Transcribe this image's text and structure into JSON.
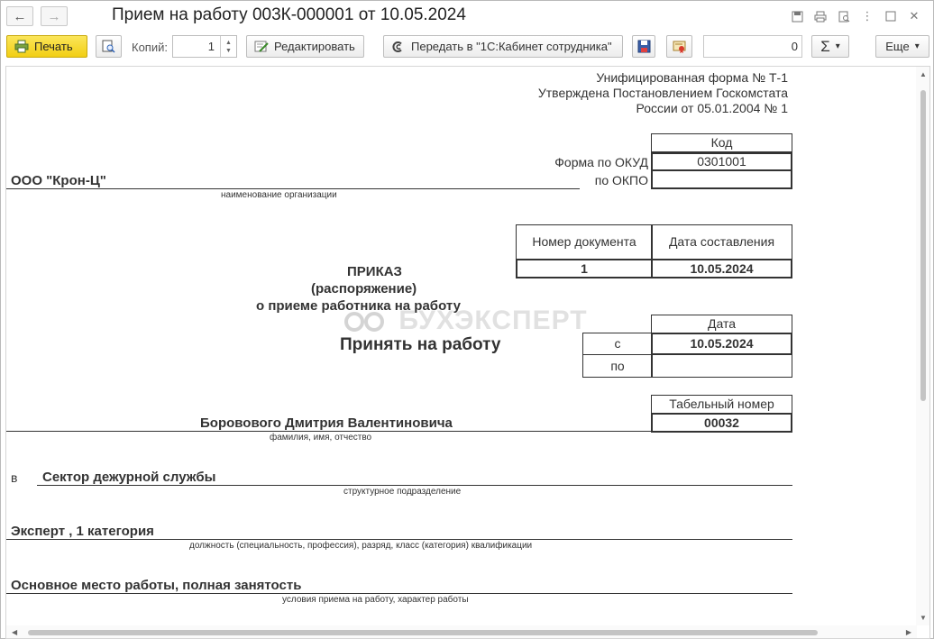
{
  "window": {
    "title": "Прием на работу 003К-000001 от 10.05.2024",
    "back_icon": "arrow-left-icon",
    "forward_icon": "arrow-right-icon"
  },
  "toolbar": {
    "print_label": "Печать",
    "copies_label": "Копий:",
    "copies_value": "1",
    "edit_label": "Редактировать",
    "send_label": "Передать в \"1С:Кабинет сотрудника\"",
    "counter_value": "0",
    "sum_label": "Σ",
    "more_label": "Еще",
    "dropdown_glyph": "▾"
  },
  "form": {
    "header_line1": "Унифицированная форма № Т-1",
    "header_line2": "Утверждена Постановлением Госкомстата",
    "header_line3": "России от 05.01.2004 № 1",
    "code_header": "Код",
    "okud_label": "Форма по ОКУД",
    "okud_value": "0301001",
    "okpo_label": "по ОКПО",
    "okpo_value": "",
    "organization": "ООО \"Крон-Ц\"",
    "organization_caption": "наименование организации",
    "doc_number_header": "Номер документа",
    "doc_date_header": "Дата составления",
    "doc_number": "1",
    "doc_date": "10.05.2024",
    "title_line1": "ПРИКАЗ",
    "title_line2": "(распоряжение)",
    "title_line3": "о приеме работника на работу",
    "watermark": "БУХЭКСПЕРТ",
    "hire_title": "Принять на работу",
    "date_header": "Дата",
    "from_label": "с",
    "from_value": "10.05.2024",
    "to_label": "по",
    "to_value": "",
    "tab_header": "Табельный номер",
    "tab_value": "00032",
    "employee_name": "Боровового Дмитрия Валентиновича",
    "employee_caption": "фамилия, имя, отчество",
    "in_label": "в",
    "department": "Сектор дежурной службы",
    "department_caption": "структурное подразделение",
    "position": "Эксперт , 1 категория",
    "position_caption": "должность (специальность, профессия), разряд, класс (категория) квалификации",
    "conditions": "Основное место работы, полная занятость",
    "conditions_caption": "условия приема на работу, характер работы"
  }
}
